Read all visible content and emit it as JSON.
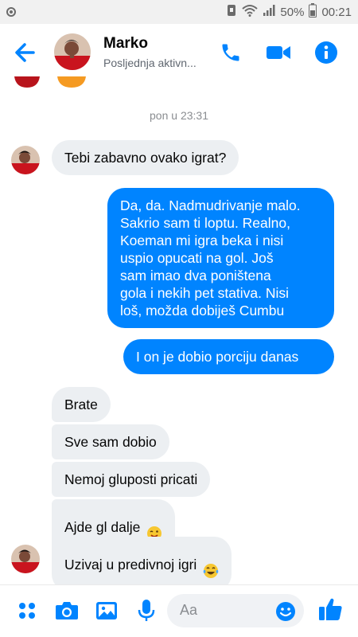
{
  "status_bar": {
    "battery": "50%",
    "time": "00:21"
  },
  "header": {
    "contact_name": "Marko",
    "subtitle": "Posljednja aktivn..."
  },
  "conversation": {
    "timestamp": "pon u 23:31",
    "messages": [
      {
        "side": "in",
        "text": "Tebi zabavno ovako igrat?"
      },
      {
        "side": "out",
        "text": "Da, da. Nadmudrivanje malo.\nSakrio sam ti loptu. Realno,\nKoeman mi igra beka i nisi\nuspio opucati na gol. Još\nsam imao dva poništena\ngola i nekih pet stativa. Nisi\nloš, možda dobiješ Cumbu"
      },
      {
        "side": "out",
        "text": "I on je dobio porciju danas"
      },
      {
        "side": "in",
        "text": "Brate"
      },
      {
        "side": "in",
        "text": "Sve sam dobio"
      },
      {
        "side": "in",
        "text": "Nemoj gluposti pricati"
      },
      {
        "side": "in",
        "text": "Ajde gl dalje"
      },
      {
        "side": "in",
        "text": "Uzivaj u predivnoj igri"
      }
    ]
  },
  "composer": {
    "placeholder": "Aa"
  },
  "colors": {
    "accent": "#0084ff",
    "incoming_bubble": "#eceff2",
    "status_bar_bg": "#f1f1f1"
  },
  "icons": [
    "back-arrow-icon",
    "phone-icon",
    "video-camera-icon",
    "info-icon",
    "more-apps-icon",
    "camera-icon",
    "image-icon",
    "microphone-icon",
    "emoji-icon",
    "thumbs-up-icon"
  ]
}
